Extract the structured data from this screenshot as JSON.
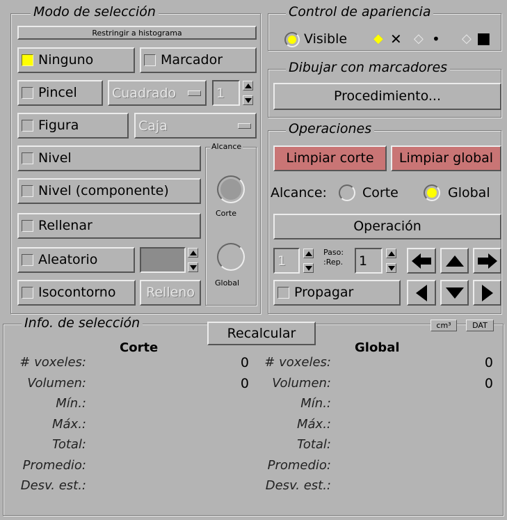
{
  "selection_mode": {
    "title": "Modo de selección",
    "restrict_button": "Restringir a histograma",
    "ninguno": "Ninguno",
    "marcador": "Marcador",
    "pincel": "Pincel",
    "pincel_shape": "Cuadrado",
    "pincel_size": "1",
    "figura": "Figura",
    "figura_shape": "Caja",
    "nivel": "Nivel",
    "nivel_componente": "Nivel (componente)",
    "rellenar": "Rellenar",
    "aleatorio": "Aleatorio",
    "isocontorno": "Isocontorno",
    "relleno": "Relleno",
    "alcance": {
      "title": "Alcance",
      "corte": "Corte",
      "global": "Global"
    }
  },
  "appearance": {
    "title": "Control de apariencia",
    "visible": "Visible",
    "symbols": [
      "◆",
      "✕",
      "◇",
      "•",
      "◇",
      "■"
    ]
  },
  "draw_markers": {
    "title": "Dibujar con marcadores",
    "procedure": "Procedimiento..."
  },
  "operations": {
    "title": "Operaciones",
    "clear_slice": "Limpiar corte",
    "clear_global": "Limpiar global",
    "scope_label": "Alcance:",
    "scope_corte": "Corte",
    "scope_global": "Global",
    "operation": "Operación",
    "rep_value": "1",
    "paso_label": "Paso:",
    "rep_label": ":Rep.",
    "paso_value": "1",
    "propagar": "Propagar"
  },
  "info": {
    "title": "Info. de selección",
    "recalc": "Recalcular",
    "unit_cm3": "cm³",
    "unit_dat": "DAT",
    "col_corte": "Corte",
    "col_global": "Global",
    "labels": [
      "# voxeles:",
      "Volumen:",
      "Mín.:",
      "Máx.:",
      "Total:",
      "Promedio:",
      "Desv. est.:"
    ],
    "corte_values": [
      "0",
      "0",
      "",
      "",
      "",
      "",
      ""
    ],
    "global_values": [
      "0",
      "0",
      "",
      "",
      "",
      "",
      ""
    ]
  },
  "colors": {
    "background": "#b4b4b4",
    "highlight": "#ffff00",
    "red_button": "#c97575"
  }
}
